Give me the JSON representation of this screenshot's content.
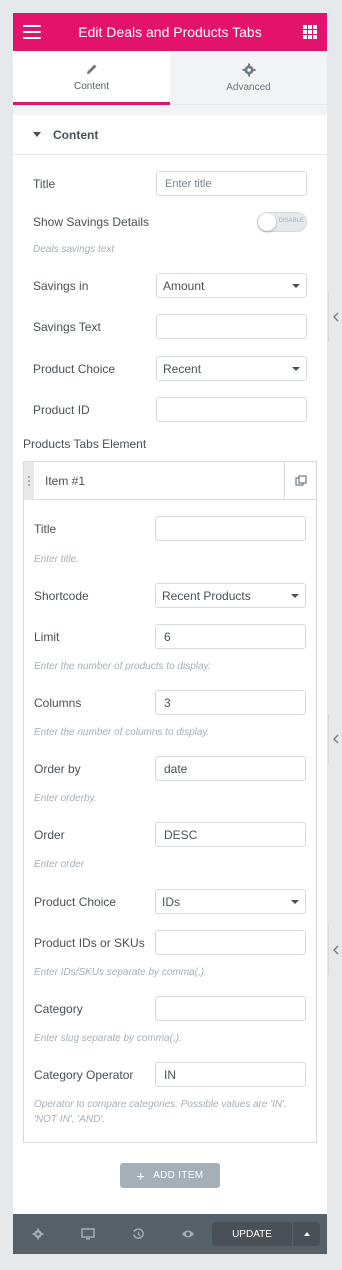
{
  "header": {
    "title": "Edit Deals and Products Tabs"
  },
  "tabs": [
    {
      "label": "Content",
      "icon": "pencil-icon"
    },
    {
      "label": "Advanced",
      "icon": "gear-icon"
    }
  ],
  "section": {
    "label": "Content"
  },
  "fields": {
    "title_label": "Title",
    "title_placeholder": "Enter title",
    "show_savings_label": "Show Savings Details",
    "toggle_text": "DISABLE",
    "deals_savings_desc": "Deals savings text",
    "savings_in_label": "Savings in",
    "savings_in_value": "Amount",
    "savings_text_label": "Savings Text",
    "savings_text_value": "",
    "product_choice_label": "Product Choice",
    "product_choice_value": "Recent",
    "product_id_label": "Product ID",
    "product_id_value": ""
  },
  "repeater": {
    "label": "Products Tabs Element",
    "item_title": "Item #1",
    "title_label": "Title",
    "title_value": "",
    "title_desc": "Enter title.",
    "shortcode_label": "Shortcode",
    "shortcode_value": "Recent Products",
    "limit_label": "Limit",
    "limit_value": "6",
    "limit_desc": "Enter the number of products to display.",
    "columns_label": "Columns",
    "columns_value": "3",
    "columns_desc": "Enter the number of columns to display.",
    "orderby_label": "Order by",
    "orderby_value": "date",
    "orderby_desc": "Enter orderby.",
    "order_label": "Order",
    "order_value": "DESC",
    "order_desc": "Enter order",
    "product_choice_label": "Product Choice",
    "product_choice_value": "IDs",
    "ids_label": "Product IDs or SKUs",
    "ids_value": "",
    "ids_desc": "Enter IDs/SKUs separate by comma(,).",
    "category_label": "Category",
    "category_value": "",
    "category_desc": "Enter slug separate by comma(,).",
    "cat_op_label": "Category Operator",
    "cat_op_value": "IN",
    "cat_op_desc": "Operator to compare categories. Possible values are 'IN', 'NOT IN', 'AND'."
  },
  "add_item_label": "ADD ITEM",
  "footer": {
    "update_label": "UPDATE"
  },
  "colors": {
    "accent": "#e3136b",
    "footer": "#556068"
  }
}
